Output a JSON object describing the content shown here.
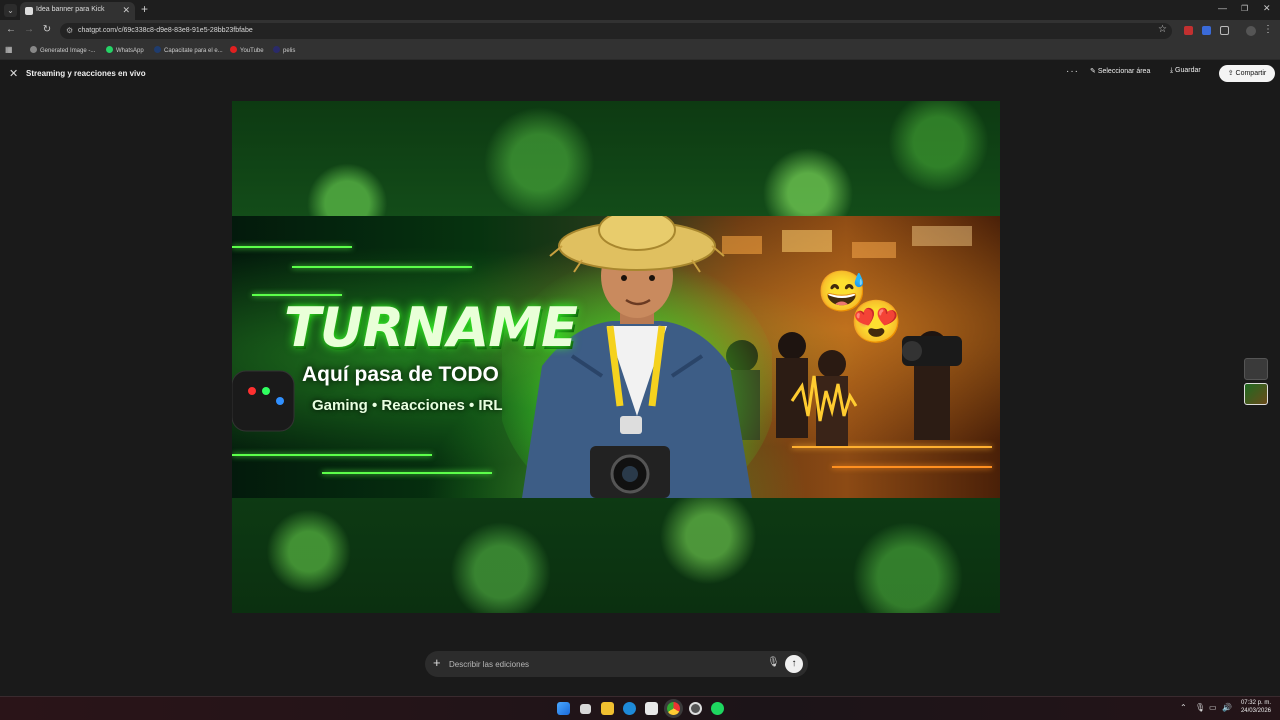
{
  "browser": {
    "tab_title": "Idea banner para Kick",
    "tab_close": "✕",
    "new_tab": "+",
    "url": "chatgpt.com/c/69c338c8-d9e8-83e8-91e5-28bb23fbfabe",
    "bookmarks": [
      "Generated Image -...",
      "WhatsApp",
      "Capacitate para el e...",
      "YouTube",
      "pelis"
    ],
    "window_controls": {
      "minimize": "—",
      "maximize": "❐",
      "close": "✕"
    }
  },
  "app": {
    "title": "Streaming y reacciones en vivo",
    "close": "✕",
    "more": "···",
    "select_area": "Seleccionar área",
    "save": "Guardar",
    "share": "Compartir"
  },
  "banner": {
    "brand": "TURNAME",
    "tagline": "Aquí pasa de TODO",
    "subtagline": "Gaming • Reacciones • IRL",
    "emoji_1": "😅",
    "emoji_2": "😍"
  },
  "prompt": {
    "placeholder": "Describir las ediciones",
    "plus": "+",
    "send": "↑"
  },
  "taskbar": {
    "time": "07:32 p. m.",
    "date": "24/03/2026"
  },
  "icons": [
    "tab-dropdown-icon",
    "back-icon",
    "forward-icon",
    "reload-icon",
    "star-icon",
    "close-icon",
    "more-icon",
    "select-area-icon",
    "download-icon",
    "share-icon",
    "plus-icon",
    "mic-icon",
    "send-icon",
    "windows-start-icon"
  ],
  "colors": {
    "accent_green": "#5cff4a",
    "page_bg": "#1a1a1a",
    "share_bg": "#f4f4f4"
  }
}
